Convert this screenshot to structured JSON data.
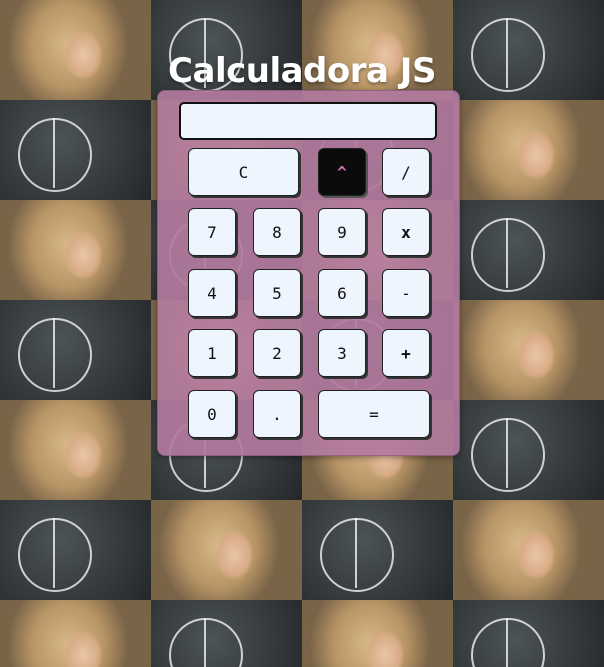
{
  "app": {
    "title": "Calculadora JS"
  },
  "calculator": {
    "display_value": "",
    "buttons": {
      "clear": "C",
      "power": "^",
      "divide": "/",
      "seven": "7",
      "eight": "8",
      "nine": "9",
      "multiply": "x",
      "four": "4",
      "five": "5",
      "six": "6",
      "subtract": "-",
      "one": "1",
      "two": "2",
      "three": "3",
      "add": "+",
      "zero": "0",
      "decimal": ".",
      "equals": "="
    }
  },
  "colors": {
    "calculator_panel": "#b27a9e",
    "button_bg": "#eef5ff",
    "active_button_bg": "#0b0b0b",
    "active_button_text": "#c86fb0",
    "title_text": "#ffffff"
  }
}
